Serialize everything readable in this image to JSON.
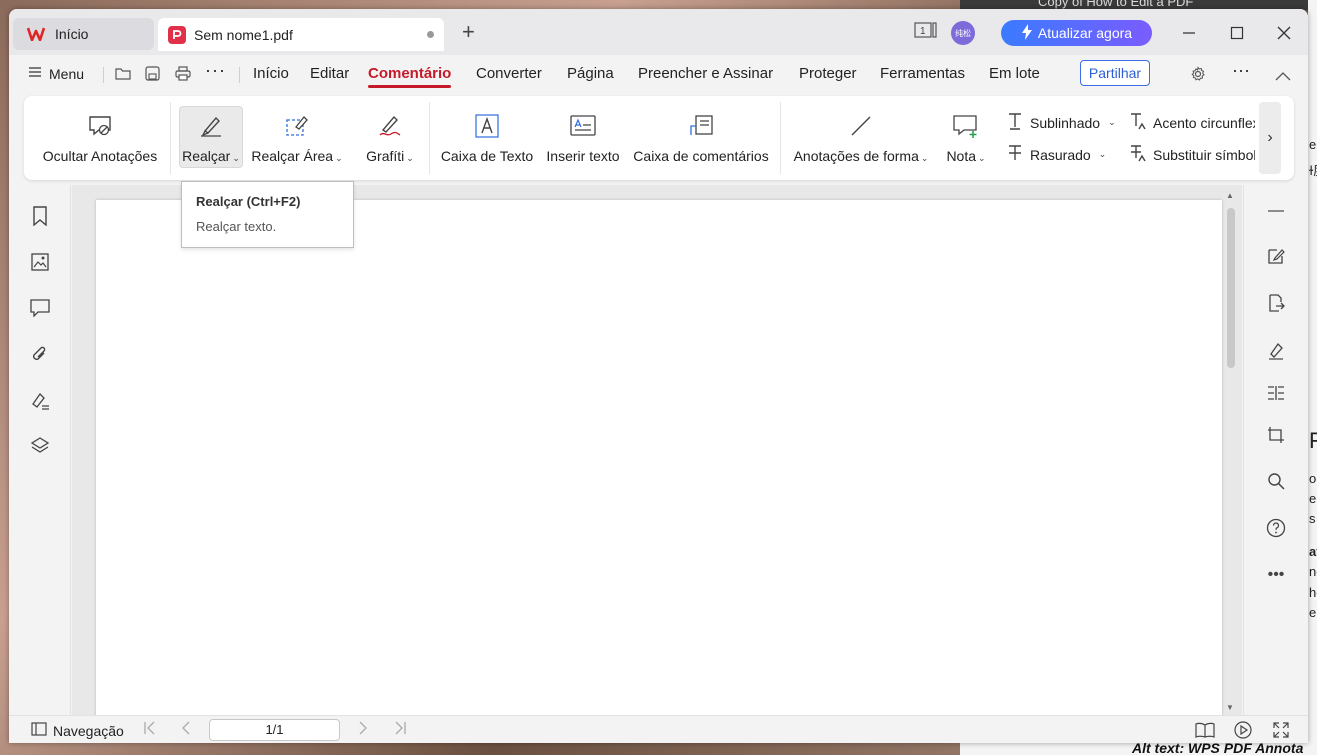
{
  "background": {
    "top_snippet": "Copy of How to Edit a PDF",
    "bottom_snippet": "Alt text: WPS PDF Annota",
    "right_fragments": [
      "ers",
      "ɫ度",
      "F",
      "olv",
      "e",
      "s c",
      "ati",
      "ng",
      "he",
      "e"
    ]
  },
  "tabs": {
    "home_label": "Início",
    "doc_label": "Sem nome1.pdf",
    "add_label": "+"
  },
  "titlebar": {
    "update_label": "Atualizar agora",
    "avatar_text": "纯松",
    "page_count_badge": "1"
  },
  "menubar": {
    "menu_label": "Menu",
    "items": [
      "Início",
      "Editar",
      "Comentário",
      "Converter",
      "Página",
      "Preencher e Assinar",
      "Proteger",
      "Ferramentas",
      "Em lote"
    ],
    "active": "Comentário",
    "share_label": "Partilhar"
  },
  "ribbon": {
    "hide_annotations": "Ocultar Anotações",
    "highlight": "Realçar",
    "area_highlight": "Realçar Área",
    "graffiti": "Grafíti",
    "text_box": "Caixa de Texto",
    "insert_text": "Inserir texto",
    "comment_box": "Caixa de comentários",
    "shape_annotations": "Anotações de forma",
    "note": "Nota",
    "underline": "Sublinhado",
    "strikethrough": "Rasurado",
    "caret": "Acento circunflexo",
    "replace_symbol": "Substituir símbolo"
  },
  "tooltip": {
    "title": "Realçar (Ctrl+F2)",
    "description": "Realçar texto."
  },
  "statusbar": {
    "navigation_label": "Navegação",
    "page_value": "1/1"
  },
  "colors": {
    "accent_red": "#c41a2a",
    "update_gradient_start": "#3a7bff",
    "update_gradient_end": "#7a5cff",
    "share_blue": "#2c5fd6"
  }
}
